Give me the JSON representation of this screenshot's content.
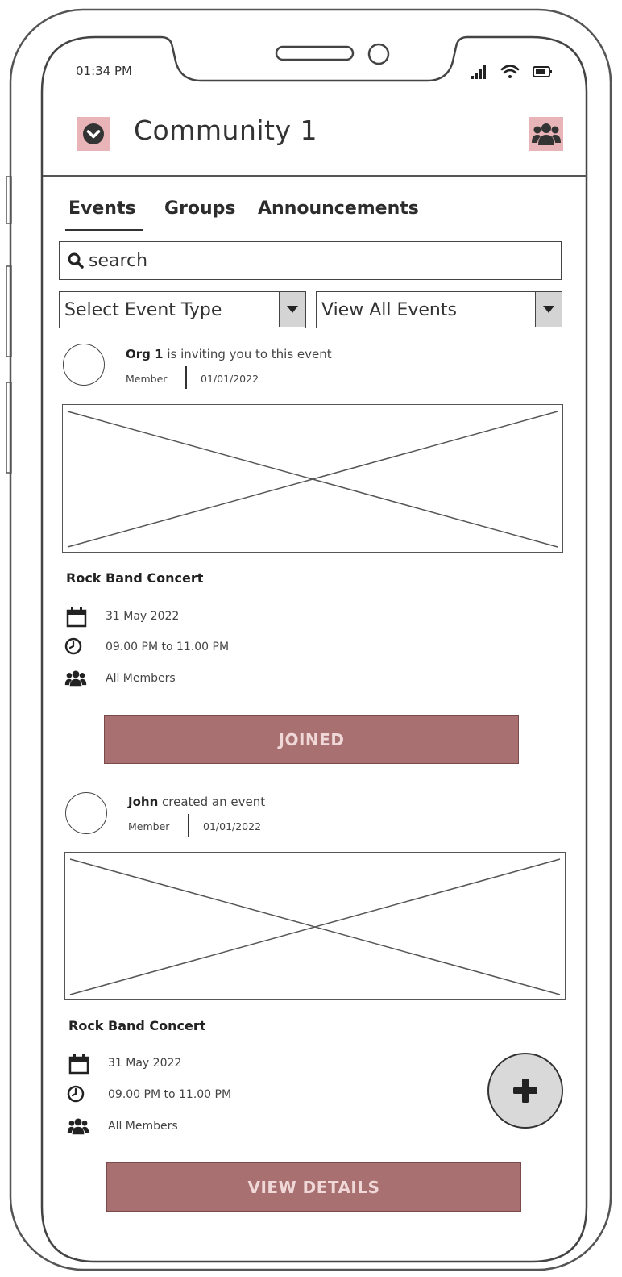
{
  "status_bar": {
    "time": "01:34 PM"
  },
  "header": {
    "title": "Community 1",
    "left_icon": "chevron-down-circle-icon",
    "right_icon": "users-icon",
    "accent_color": "#e8b4b8"
  },
  "tabs": [
    {
      "label": "Events",
      "active": true
    },
    {
      "label": "Groups",
      "active": false
    },
    {
      "label": "Announcements",
      "active": false
    }
  ],
  "search": {
    "placeholder": "search"
  },
  "filters": {
    "event_type": "Select Event Type",
    "event_view": "View All Events"
  },
  "posts": [
    {
      "author": "Org 1",
      "action": "is inviting you to this event",
      "role": "Member",
      "date": "01/01/2022",
      "event_title": "Rock Band Concert",
      "event_date": "31 May 2022",
      "event_time": "09.00 PM to 11.00 PM",
      "audience": "All Members",
      "button_label": "JOINED"
    },
    {
      "author": "John",
      "action": "created an event",
      "role": "Member",
      "date": "01/01/2022",
      "event_title": "Rock Band Concert",
      "event_date": "31 May 2022",
      "event_time": "09.00 PM to 11.00 PM",
      "audience": "All Members",
      "button_label": "VIEW DETAILS"
    }
  ],
  "fab": {
    "icon": "plus-icon"
  },
  "colors": {
    "button": "#a87070",
    "button_text": "#f0d8d8",
    "fab": "#d9d9d9"
  }
}
